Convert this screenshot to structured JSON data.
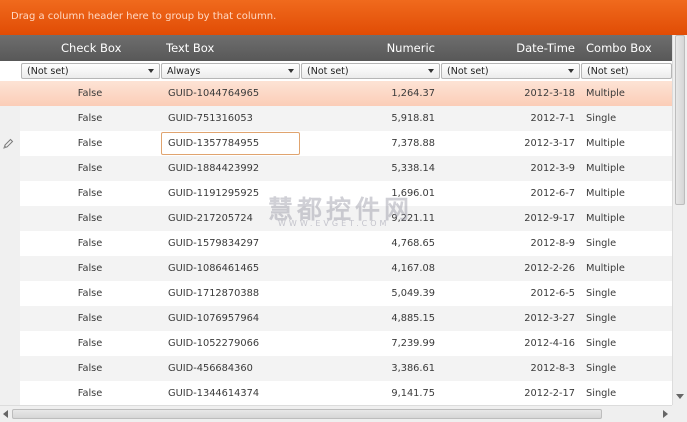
{
  "group_panel": {
    "hint": "Drag a column header here to group by that column."
  },
  "columns": [
    {
      "label": "Check Box"
    },
    {
      "label": "Text Box"
    },
    {
      "label": "Numeric"
    },
    {
      "label": "Date-Time"
    },
    {
      "label": "Combo Box"
    }
  ],
  "filters": [
    {
      "value": "(Not set)"
    },
    {
      "value": "Always"
    },
    {
      "value": "(Not set)"
    },
    {
      "value": "(Not set)"
    },
    {
      "value": "(Not set)"
    }
  ],
  "rows": [
    {
      "check": "False",
      "text": "GUID-1044764965",
      "numeric": "1,264.37",
      "date": "2012-3-18",
      "combo": "Multiple"
    },
    {
      "check": "False",
      "text": "GUID-751316053",
      "numeric": "5,918.81",
      "date": "2012-7-1",
      "combo": "Single"
    },
    {
      "check": "False",
      "text": "GUID-1357784955",
      "numeric": "7,378.88",
      "date": "2012-3-17",
      "combo": "Multiple"
    },
    {
      "check": "False",
      "text": "GUID-1884423992",
      "numeric": "5,338.14",
      "date": "2012-3-9",
      "combo": "Multiple"
    },
    {
      "check": "False",
      "text": "GUID-1191295925",
      "numeric": "1,696.01",
      "date": "2012-6-7",
      "combo": "Multiple"
    },
    {
      "check": "False",
      "text": "GUID-217205724",
      "numeric": "9,221.11",
      "date": "2012-9-17",
      "combo": "Multiple"
    },
    {
      "check": "False",
      "text": "GUID-1579834297",
      "numeric": "4,768.65",
      "date": "2012-8-9",
      "combo": "Single"
    },
    {
      "check": "False",
      "text": "GUID-1086461465",
      "numeric": "4,167.08",
      "date": "2012-2-26",
      "combo": "Multiple"
    },
    {
      "check": "False",
      "text": "GUID-1712870388",
      "numeric": "5,049.39",
      "date": "2012-6-5",
      "combo": "Single"
    },
    {
      "check": "False",
      "text": "GUID-1076957964",
      "numeric": "4,885.15",
      "date": "2012-3-27",
      "combo": "Single"
    },
    {
      "check": "False",
      "text": "GUID-1052279066",
      "numeric": "7,239.99",
      "date": "2012-4-16",
      "combo": "Single"
    },
    {
      "check": "False",
      "text": "GUID-456684360",
      "numeric": "3,386.61",
      "date": "2012-8-3",
      "combo": "Single"
    },
    {
      "check": "False",
      "text": "GUID-1344614374",
      "numeric": "9,141.75",
      "date": "2012-2-17",
      "combo": "Single"
    }
  ],
  "selected_row": 0,
  "editing_row": 2,
  "watermark": {
    "text": "慧都控件网",
    "url": "WWW.EVGET.COM"
  },
  "colors": {
    "accent": "#e65a0f",
    "header": "#636363",
    "selected_row": "#fcd8c6",
    "edit_border": "#e0a46f"
  },
  "icons": {
    "row_indicator": "pencil-icon"
  }
}
